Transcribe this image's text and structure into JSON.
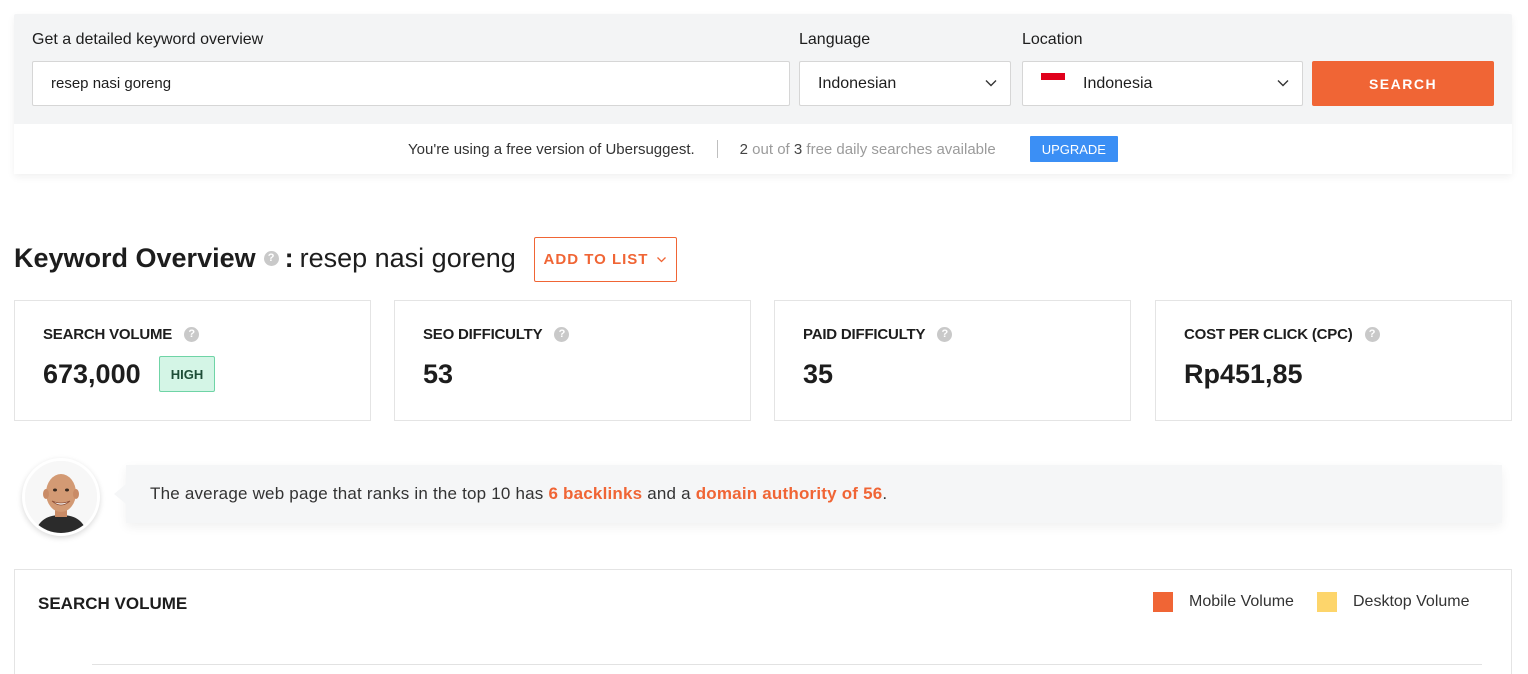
{
  "search": {
    "keyword_label": "Get a detailed keyword overview",
    "keyword_value": "resep nasi goreng",
    "language_label": "Language",
    "language_value": "Indonesian",
    "location_label": "Location",
    "location_value": "Indonesia",
    "location_flag": "indonesia-flag-icon",
    "search_button": "SEARCH"
  },
  "free_notice": {
    "text": "You're using a free version of Ubersuggest.",
    "count_used": "2",
    "count_mid": " out of ",
    "count_total": "3",
    "count_suffix": " free daily searches available",
    "upgrade_button": "UPGRADE"
  },
  "overview": {
    "title": "Keyword Overview",
    "colon": ":",
    "keyword": "resep nasi goreng",
    "add_to_list": "ADD TO LIST"
  },
  "metrics": [
    {
      "title": "SEARCH VOLUME",
      "value": "673,000",
      "badge": "HIGH"
    },
    {
      "title": "SEO DIFFICULTY",
      "value": "53"
    },
    {
      "title": "PAID DIFFICULTY",
      "value": "35"
    },
    {
      "title": "COST PER CLICK (CPC)",
      "value": "Rp451,85"
    }
  ],
  "tip": {
    "prefix": "The average web page that ranks in the top 10 has ",
    "backlinks": "6 backlinks",
    "middle": " and a ",
    "authority": "domain authority of 56",
    "suffix": "."
  },
  "search_volume_chart": {
    "title": "SEARCH VOLUME",
    "legend": [
      {
        "label": "Mobile Volume",
        "color": "#f06535"
      },
      {
        "label": "Desktop Volume",
        "color": "#fdd56b"
      }
    ]
  },
  "colors": {
    "accent": "#f06535",
    "upgrade": "#3b8ff5",
    "badge_high": "#d4f5e6"
  }
}
